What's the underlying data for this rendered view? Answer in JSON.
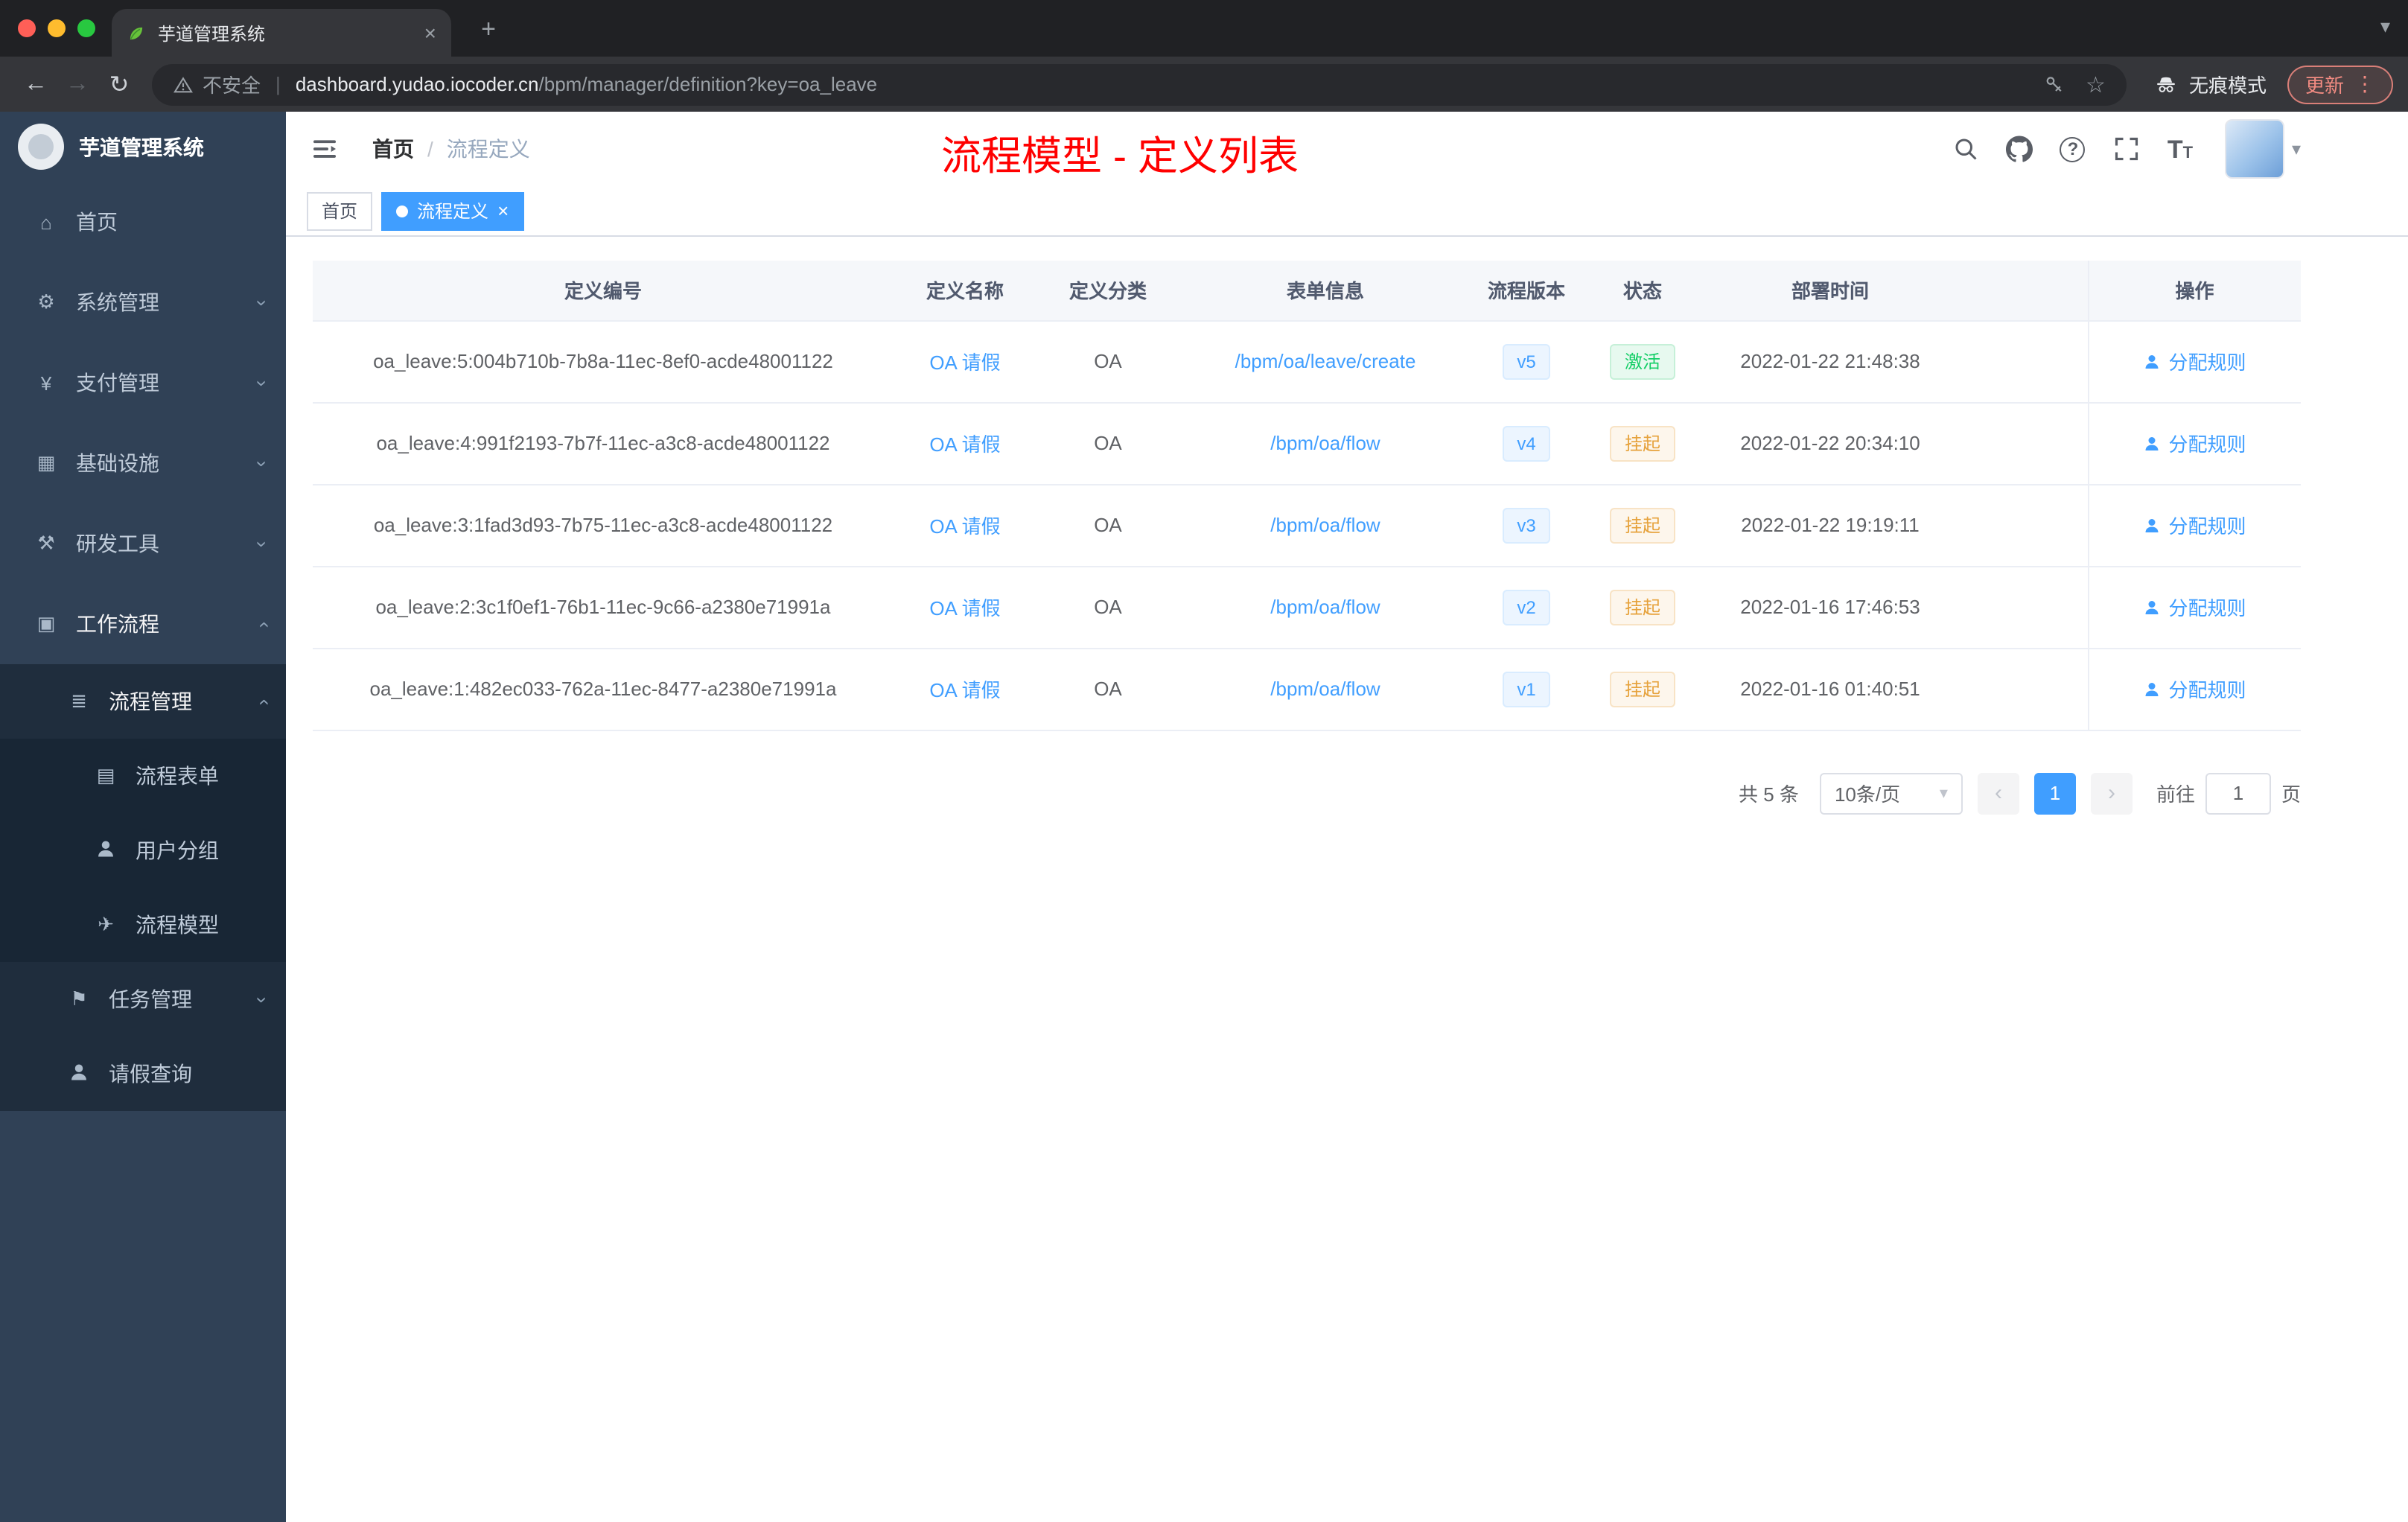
{
  "colors": {
    "accent": "#409eff",
    "success": "#13ce66",
    "warning": "#e6a23c",
    "page_title_red": "#ff0000",
    "sidebar_bg": "#304156",
    "submenu_bg": "#1f2d3d"
  },
  "icons": {
    "home": "⌂",
    "gear": "⚙",
    "yen": "¥",
    "infra": "▦",
    "tools": "⚒",
    "workflow": "▣",
    "process": "≣",
    "form": "▤",
    "model": "✈",
    "task": "⚑",
    "chevron": "›",
    "caret": "▾",
    "close": "×",
    "plus": "+",
    "back": "←",
    "forward": "→",
    "reload": "↻",
    "more": "⋮",
    "star": "☆",
    "prev": "‹",
    "next": "›"
  },
  "browser": {
    "tab_title": "芋道管理系统",
    "security": "不安全",
    "url_host": "dashboard.yudao.iocoder.cn",
    "url_path": "/bpm/manager/definition?key=oa_leave",
    "incognito": "无痕模式",
    "update": "更新"
  },
  "sidebar": {
    "logo_title": "芋道管理系统",
    "items": [
      {
        "label": "首页"
      },
      {
        "label": "系统管理"
      },
      {
        "label": "支付管理"
      },
      {
        "label": "基础设施"
      },
      {
        "label": "研发工具"
      },
      {
        "label": "工作流程"
      }
    ],
    "process_group": {
      "label": "流程管理",
      "children": [
        {
          "label": "流程表单"
        },
        {
          "label": "用户分组"
        },
        {
          "label": "流程模型"
        }
      ]
    },
    "task_group": {
      "label": "任务管理"
    },
    "leave_item": {
      "label": "请假查询"
    }
  },
  "header": {
    "breadcrumb": [
      "首页",
      "流程定义"
    ],
    "separator": "/",
    "title": "流程模型 - 定义列表"
  },
  "tagbar": {
    "tags": [
      {
        "label": "首页"
      },
      {
        "label": "流程定义"
      }
    ]
  },
  "table": {
    "columns": [
      "定义编号",
      "定义名称",
      "定义分类",
      "表单信息",
      "流程版本",
      "状态",
      "部署时间",
      "操作"
    ],
    "rows": [
      {
        "id": "oa_leave:5:004b710b-7b8a-11ec-8ef0-acde48001122",
        "name": "OA 请假",
        "category": "OA",
        "form": "/bpm/oa/leave/create",
        "version": "v5",
        "status": "激活",
        "time": "2022-01-22 21:48:38",
        "action": "分配规则"
      },
      {
        "id": "oa_leave:4:991f2193-7b7f-11ec-a3c8-acde48001122",
        "name": "OA 请假",
        "category": "OA",
        "form": "/bpm/oa/flow",
        "version": "v4",
        "status": "挂起",
        "time": "2022-01-22 20:34:10",
        "action": "分配规则"
      },
      {
        "id": "oa_leave:3:1fad3d93-7b75-11ec-a3c8-acde48001122",
        "name": "OA 请假",
        "category": "OA",
        "form": "/bpm/oa/flow",
        "version": "v3",
        "status": "挂起",
        "time": "2022-01-22 19:19:11",
        "action": "分配规则"
      },
      {
        "id": "oa_leave:2:3c1f0ef1-76b1-11ec-9c66-a2380e71991a",
        "name": "OA 请假",
        "category": "OA",
        "form": "/bpm/oa/flow",
        "version": "v2",
        "status": "挂起",
        "time": "2022-01-16 17:46:53",
        "action": "分配规则"
      },
      {
        "id": "oa_leave:1:482ec033-762a-11ec-8477-a2380e71991a",
        "name": "OA 请假",
        "category": "OA",
        "form": "/bpm/oa/flow",
        "version": "v1",
        "status": "挂起",
        "time": "2022-01-16 01:40:51",
        "action": "分配规则"
      }
    ]
  },
  "pagination": {
    "total": "共 5 条",
    "page_size": "10条/页",
    "current_page": "1",
    "goto_label": "前往",
    "goto_value": "1",
    "page_unit": "页"
  }
}
